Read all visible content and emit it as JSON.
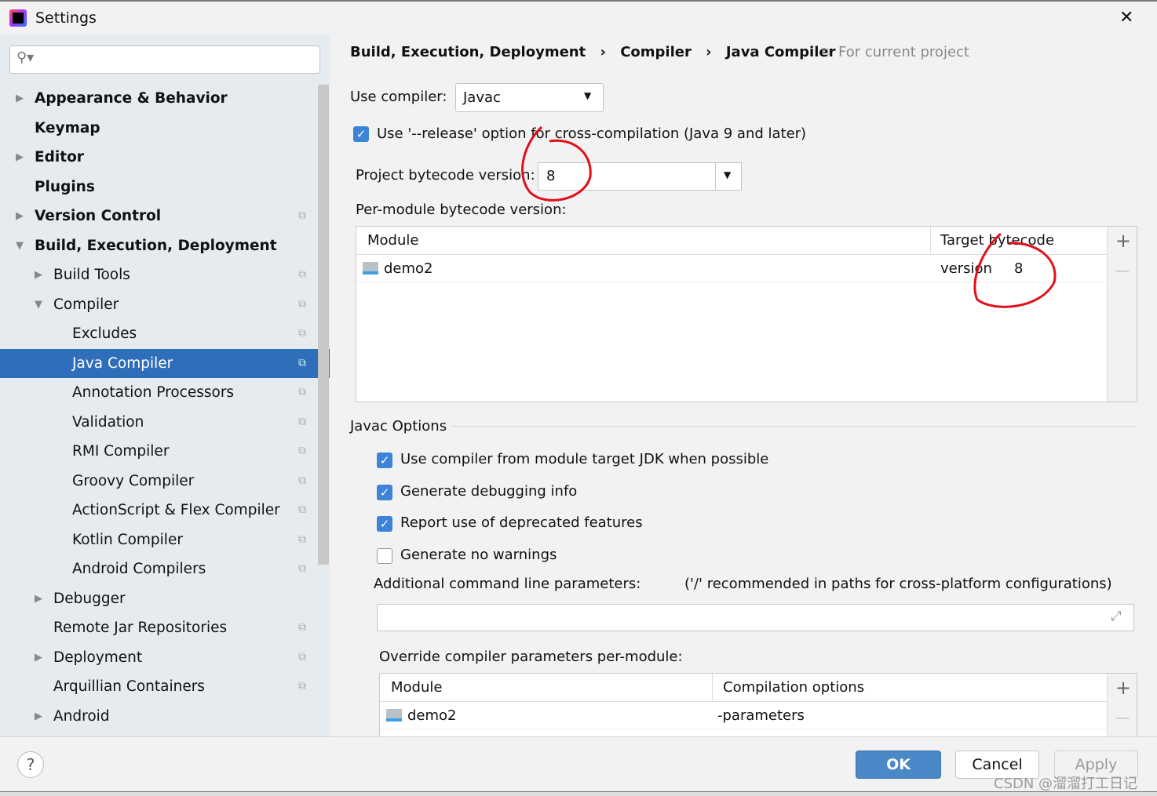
{
  "window": {
    "title": "Settings",
    "close": "✕"
  },
  "search": {
    "placeholder": ""
  },
  "sidebar": {
    "items": [
      {
        "label": "Appearance & Behavior",
        "level": 0,
        "bold": true,
        "arrow": "▶",
        "copy": false
      },
      {
        "label": "Keymap",
        "level": 0,
        "bold": true,
        "arrow": "",
        "copy": false
      },
      {
        "label": "Editor",
        "level": 0,
        "bold": true,
        "arrow": "▶",
        "copy": false
      },
      {
        "label": "Plugins",
        "level": 0,
        "bold": true,
        "arrow": "",
        "copy": false
      },
      {
        "label": "Version Control",
        "level": 0,
        "bold": true,
        "arrow": "▶",
        "copy": true
      },
      {
        "label": "Build, Execution, Deployment",
        "level": 0,
        "bold": true,
        "arrow": "▼",
        "copy": false
      },
      {
        "label": "Build Tools",
        "level": 1,
        "arrow": "▶",
        "copy": true
      },
      {
        "label": "Compiler",
        "level": 1,
        "arrow": "▼",
        "copy": true
      },
      {
        "label": "Excludes",
        "level": 2,
        "arrow": "",
        "copy": true
      },
      {
        "label": "Java Compiler",
        "level": 2,
        "arrow": "",
        "copy": true,
        "selected": true
      },
      {
        "label": "Annotation Processors",
        "level": 2,
        "arrow": "",
        "copy": true
      },
      {
        "label": "Validation",
        "level": 2,
        "arrow": "",
        "copy": true
      },
      {
        "label": "RMI Compiler",
        "level": 2,
        "arrow": "",
        "copy": true
      },
      {
        "label": "Groovy Compiler",
        "level": 2,
        "arrow": "",
        "copy": true
      },
      {
        "label": "ActionScript & Flex Compiler",
        "level": 2,
        "arrow": "",
        "copy": true
      },
      {
        "label": "Kotlin Compiler",
        "level": 2,
        "arrow": "",
        "copy": true
      },
      {
        "label": "Android Compilers",
        "level": 2,
        "arrow": "",
        "copy": true
      },
      {
        "label": "Debugger",
        "level": 1,
        "arrow": "▶",
        "copy": false
      },
      {
        "label": "Remote Jar Repositories",
        "level": 1,
        "arrow": "",
        "copy": true
      },
      {
        "label": "Deployment",
        "level": 1,
        "arrow": "▶",
        "copy": true
      },
      {
        "label": "Arquillian Containers",
        "level": 1,
        "arrow": "",
        "copy": true
      },
      {
        "label": "Android",
        "level": 1,
        "arrow": "▶",
        "copy": false
      }
    ]
  },
  "breadcrumb": {
    "items": [
      "Build, Execution, Deployment",
      "Compiler",
      "Java Compiler"
    ],
    "sep": "›",
    "scope": "For current project"
  },
  "compiler": {
    "label": "Use compiler:",
    "value": "Javac"
  },
  "release": {
    "label": "Use '--release' option for cross-compilation (Java 9 and later)",
    "checked": true
  },
  "bytecode": {
    "label": "Project bytecode version:",
    "value": "8"
  },
  "per_module": {
    "label": "Per-module bytecode version:",
    "columns": [
      "Module",
      "Target bytecode version"
    ],
    "rows": [
      {
        "module": "demo2",
        "version": "8"
      }
    ]
  },
  "javac": {
    "title": "Javac Options",
    "options": [
      {
        "label": "Use compiler from module target JDK when possible",
        "checked": true
      },
      {
        "label": "Generate debugging info",
        "checked": true
      },
      {
        "label": "Report use of deprecated features",
        "checked": true
      },
      {
        "label": "Generate no warnings",
        "checked": false
      }
    ],
    "additional_label": "Additional command line parameters:",
    "additional_hint": "('/' recommended in paths for cross-platform configurations)",
    "additional_value": ""
  },
  "override": {
    "label": "Override compiler parameters per-module:",
    "columns": [
      "Module",
      "Compilation options"
    ],
    "rows": [
      {
        "module": "demo2",
        "options": "-parameters"
      }
    ]
  },
  "buttons": {
    "ok": "OK",
    "cancel": "Cancel",
    "apply": "Apply",
    "help": "?",
    "add": "+",
    "remove": "—"
  },
  "watermark": "CSDN @溜溜打工日记",
  "colors": {
    "selection": "#2f6fba",
    "ok": "#4a88c7",
    "annotation": "#e0101a"
  }
}
